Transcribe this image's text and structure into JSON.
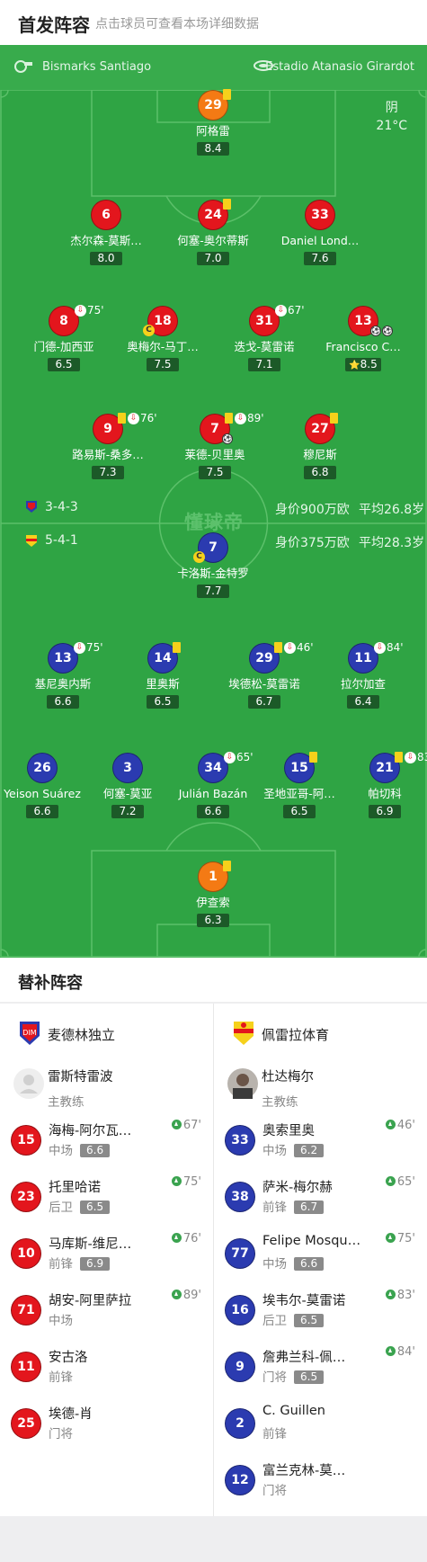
{
  "header": {
    "title": "首发阵容",
    "subtitle": "点击球员可查看本场详细数据"
  },
  "match_info": {
    "referee": "Bismarks Santiago",
    "stadium": "Estadio Atanasio Girardot",
    "weather": "阴",
    "temperature": "21°C"
  },
  "watermark": "懂球帝",
  "teams": {
    "home": {
      "name": "麦德林独立",
      "formation": "3-4-3",
      "value": "身价900万欧",
      "avg_age": "平均26.8岁",
      "coach": "雷斯特雷波",
      "coach_role": "主教练",
      "color": "#e3161d"
    },
    "away": {
      "name": "佩雷拉体育",
      "formation": "5-4-1",
      "value": "身价375万欧",
      "avg_age": "平均28.3岁",
      "coach": "杜达梅尔",
      "coach_role": "主教练",
      "color": "#2b3bb0"
    }
  },
  "home_players": [
    {
      "number": "29",
      "name": "阿格雷",
      "rating": "8.4",
      "gk": true,
      "yellow": 1
    },
    {
      "number": "6",
      "name": "杰尔森-莫斯…",
      "rating": "8.0"
    },
    {
      "number": "24",
      "name": "何塞-奥尔蒂斯",
      "rating": "7.0",
      "yellow": 1
    },
    {
      "number": "33",
      "name": "Daniel Lond…",
      "rating": "7.6"
    },
    {
      "number": "8",
      "name": "门德-加西亚",
      "rating": "6.5",
      "sub_off": "75'"
    },
    {
      "number": "18",
      "name": "奥梅尔-马丁…",
      "rating": "7.5",
      "captain": "C"
    },
    {
      "number": "31",
      "name": "迭戈-莫雷诺",
      "rating": "7.1",
      "sub_off": "67'"
    },
    {
      "number": "13",
      "name": "Francisco C…",
      "rating": "8.5",
      "goals": 2,
      "star": "⭐"
    },
    {
      "number": "9",
      "name": "路易斯-桑多…",
      "rating": "7.3",
      "yellow": 1,
      "sub_off": "76'"
    },
    {
      "number": "7",
      "name": "莱德-贝里奥",
      "rating": "7.5",
      "yellow": 1,
      "sub_off": "89'",
      "goals": 1
    },
    {
      "number": "27",
      "name": "穆尼斯",
      "rating": "6.8",
      "yellow": 1
    }
  ],
  "away_players": [
    {
      "number": "7",
      "name": "卡洛斯-金特罗",
      "rating": "7.7",
      "captain": "C"
    },
    {
      "number": "13",
      "name": "基尼奥内斯",
      "rating": "6.6",
      "sub_off": "75'"
    },
    {
      "number": "14",
      "name": "里奥斯",
      "rating": "6.5",
      "yellow": 1
    },
    {
      "number": "29",
      "name": "埃德松-莫雷诺",
      "rating": "6.7",
      "yellow": 1,
      "sub_off": "46'"
    },
    {
      "number": "11",
      "name": "拉尔加查",
      "rating": "6.4",
      "sub_off": "84'"
    },
    {
      "number": "26",
      "name": "Yeison Suárez",
      "rating": "6.6"
    },
    {
      "number": "3",
      "name": "何塞-莫亚",
      "rating": "7.2"
    },
    {
      "number": "34",
      "name": "Julián Bazán",
      "rating": "6.6",
      "sub_off": "65'"
    },
    {
      "number": "15",
      "name": "圣地亚哥-阿…",
      "rating": "6.5",
      "yellow": 1
    },
    {
      "number": "21",
      "name": "帕切科",
      "rating": "6.9",
      "yellow": 1,
      "sub_off": "83'"
    },
    {
      "number": "1",
      "name": "伊查索",
      "rating": "6.3",
      "gk": true,
      "yellow": 1
    }
  ],
  "subs_title": "替补阵容",
  "home_subs": [
    {
      "number": "15",
      "name": "海梅-阿尔瓦…",
      "pos": "中场",
      "rating": "6.6",
      "on": "67'"
    },
    {
      "number": "23",
      "name": "托里哈诺",
      "pos": "后卫",
      "rating": "6.5",
      "on": "75'"
    },
    {
      "number": "10",
      "name": "马库斯-维尼…",
      "pos": "前锋",
      "rating": "6.9",
      "on": "76'"
    },
    {
      "number": "71",
      "name": "胡安-阿里萨拉",
      "pos": "中场",
      "rating": "",
      "on": "89'"
    },
    {
      "number": "11",
      "name": "安古洛",
      "pos": "前锋",
      "rating": "",
      "on": ""
    },
    {
      "number": "25",
      "name": "埃德-肖",
      "pos": "门将",
      "rating": "",
      "on": ""
    }
  ],
  "away_subs": [
    {
      "number": "33",
      "name": "奥索里奥",
      "pos": "中场",
      "rating": "6.2",
      "on": "46'"
    },
    {
      "number": "38",
      "name": "萨米-梅尔赫",
      "pos": "前锋",
      "rating": "6.7",
      "on": "65'"
    },
    {
      "number": "77",
      "name": "Felipe Mosqu…",
      "pos": "中场",
      "rating": "6.6",
      "on": "75'"
    },
    {
      "number": "16",
      "name": "埃韦尔-莫雷诺",
      "pos": "后卫",
      "rating": "6.5",
      "on": "83'"
    },
    {
      "number": "9",
      "name": "詹弗兰科-佩…",
      "pos": "门将",
      "rating": "6.5",
      "on": "84'"
    },
    {
      "number": "2",
      "name": "C. Guillen",
      "pos": "前锋",
      "rating": "",
      "on": ""
    },
    {
      "number": "12",
      "name": "富兰克林-莫…",
      "pos": "门将",
      "rating": "",
      "on": ""
    }
  ]
}
